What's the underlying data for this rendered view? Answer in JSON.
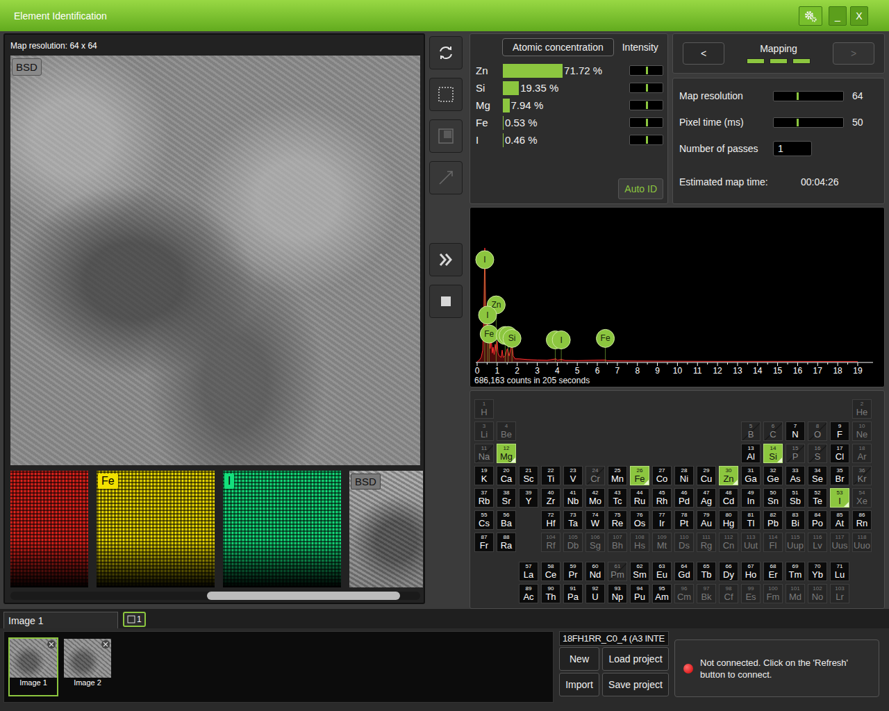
{
  "window": {
    "title": "Element Identification",
    "controls": [
      {
        "kind": "gear",
        "label": ""
      },
      {
        "kind": "minimize",
        "label": "_"
      },
      {
        "kind": "close",
        "label": "X"
      }
    ]
  },
  "image_panel": {
    "header": "Map resolution: 64 x 64",
    "badge": "BSD",
    "maps": [
      {
        "label": "",
        "kind": "color",
        "color": "#e2231c"
      },
      {
        "label": "Fe",
        "kind": "color",
        "color": "#f2e000"
      },
      {
        "label": "I",
        "kind": "color",
        "color": "#14e07c"
      },
      {
        "label": "BSD",
        "kind": "grayscale",
        "color": "#9a9a9a"
      }
    ]
  },
  "toolbar": [
    {
      "kind": "refresh",
      "disabled": false
    },
    {
      "kind": "select-area",
      "disabled": false
    },
    {
      "kind": "crop",
      "disabled": true
    },
    {
      "kind": "line",
      "disabled": true
    },
    {
      "kind": "next",
      "disabled": false
    },
    {
      "kind": "stop",
      "disabled": false
    }
  ],
  "concentration": {
    "tab": "Atomic concentration",
    "intensity_header": "Intensity",
    "auto_id": "Auto ID",
    "rows": [
      {
        "element": "Zn",
        "value": "71.72 %",
        "level": 0.7172,
        "intensity": 0.5
      },
      {
        "element": "Si",
        "value": "19.35 %",
        "level": 0.1935,
        "intensity": 0.5
      },
      {
        "element": "Mg",
        "value": "7.94 %",
        "level": 0.0794,
        "intensity": 0.5
      },
      {
        "element": "Fe",
        "value": "0.53 %",
        "level": 0.0053,
        "intensity": 0.5
      },
      {
        "element": "I",
        "value": "0.46 %",
        "level": 0.0046,
        "intensity": 0.5
      }
    ]
  },
  "mapping": {
    "prev": {
      "label": "<",
      "disabled": false
    },
    "title": "Mapping",
    "next": {
      "label": ">",
      "disabled": true
    },
    "steps": [
      {
        "on": true
      },
      {
        "on": true
      },
      {
        "on": true
      }
    ],
    "settings": [
      {
        "kind": "slider",
        "label": "Map resolution",
        "level": 0.33,
        "value": "64"
      },
      {
        "kind": "slider",
        "label": "Pixel time (ms)",
        "level": 0.33,
        "value": "50"
      },
      {
        "kind": "input",
        "label": "Number of passes",
        "value": "1"
      },
      {
        "kind": "readout",
        "label": "Estimated map time:",
        "value": "00:04:26"
      }
    ]
  },
  "spectrum": {
    "x_ticks": [
      "0",
      "1",
      "2",
      "3",
      "4",
      "5",
      "6",
      "7",
      "8",
      "9",
      "10",
      "11",
      "12",
      "13",
      "14",
      "15",
      "16",
      "17",
      "18",
      "19"
    ],
    "energies_keV": [
      0,
      0.1,
      0.2,
      0.28,
      0.33,
      0.38,
      0.42,
      0.47,
      0.52,
      0.56,
      0.6,
      0.65,
      0.7,
      0.76,
      0.8,
      0.85,
      0.9,
      0.95,
      1.0,
      1.04,
      1.1,
      1.2,
      1.25,
      1.3,
      1.4,
      1.5,
      1.6,
      1.74,
      1.8,
      1.9,
      2.1,
      2.5,
      3.0,
      3.5,
      3.94,
      4.0,
      4.2,
      4.4,
      5,
      6.4,
      6.5,
      7,
      8,
      10,
      12,
      15,
      19
    ],
    "counts": [
      0,
      1,
      3,
      8,
      30,
      78,
      40,
      18,
      32,
      14,
      22,
      9,
      16,
      6,
      10,
      5,
      12,
      7,
      14,
      6,
      4,
      3,
      8,
      3,
      4,
      9,
      4,
      13,
      4,
      2,
      2,
      1.5,
      1.2,
      1,
      2,
      1,
      1.6,
      0.9,
      0.8,
      1.2,
      0.7,
      0.6,
      0.5,
      0.4,
      0.3,
      0.3,
      0.2
    ],
    "markers": [
      {
        "label": "I",
        "energy": 0.38,
        "counts": 70
      },
      {
        "label": "Zn",
        "energy": 0.95,
        "counts": 39
      },
      {
        "label": "I",
        "energy": 0.52,
        "counts": 32
      },
      {
        "label": "Fe",
        "energy": 0.6,
        "counts": 19
      },
      {
        "label": "",
        "energy": 1.4,
        "counts": 18
      },
      {
        "label": "",
        "energy": 1.55,
        "counts": 18
      },
      {
        "label": "Si",
        "energy": 1.74,
        "counts": 16
      },
      {
        "label": "",
        "energy": 3.9,
        "counts": 15
      },
      {
        "label": "I",
        "energy": 4.2,
        "counts": 15
      },
      {
        "label": "Fe",
        "energy": 6.4,
        "counts": 16
      }
    ],
    "summary": "686,163 counts in 205 seconds"
  },
  "periodic_table": {
    "elements": [
      {
        "z": "1",
        "symbol": "H",
        "state": "disabled"
      },
      {
        "z": "2",
        "symbol": "He",
        "state": "disabled"
      },
      {
        "z": "3",
        "symbol": "Li",
        "state": "disabled"
      },
      {
        "z": "4",
        "symbol": "Be",
        "state": "disabled"
      },
      {
        "z": "5",
        "symbol": "B",
        "state": "excluded"
      },
      {
        "z": "6",
        "symbol": "C",
        "state": "excluded"
      },
      {
        "z": "7",
        "symbol": "N",
        "state": "normal"
      },
      {
        "z": "8",
        "symbol": "O",
        "state": "excluded"
      },
      {
        "z": "9",
        "symbol": "F",
        "state": "normal"
      },
      {
        "z": "10",
        "symbol": "Ne",
        "state": "disabled"
      },
      {
        "z": "11",
        "symbol": "Na",
        "state": "excluded"
      },
      {
        "z": "12",
        "symbol": "Mg",
        "state": "selected"
      },
      {
        "z": "13",
        "symbol": "Al",
        "state": "normal"
      },
      {
        "z": "14",
        "symbol": "Si",
        "state": "selected"
      },
      {
        "z": "15",
        "symbol": "P",
        "state": "excluded"
      },
      {
        "z": "16",
        "symbol": "S",
        "state": "excluded"
      },
      {
        "z": "17",
        "symbol": "Cl",
        "state": "normal"
      },
      {
        "z": "18",
        "symbol": "Ar",
        "state": "disabled"
      },
      {
        "z": "19",
        "symbol": "K",
        "state": "normal"
      },
      {
        "z": "20",
        "symbol": "Ca",
        "state": "normal"
      },
      {
        "z": "21",
        "symbol": "Sc",
        "state": "normal"
      },
      {
        "z": "22",
        "symbol": "Ti",
        "state": "normal"
      },
      {
        "z": "23",
        "symbol": "V",
        "state": "normal"
      },
      {
        "z": "24",
        "symbol": "Cr",
        "state": "excluded"
      },
      {
        "z": "25",
        "symbol": "Mn",
        "state": "normal"
      },
      {
        "z": "26",
        "symbol": "Fe",
        "state": "selected"
      },
      {
        "z": "27",
        "symbol": "Co",
        "state": "normal"
      },
      {
        "z": "28",
        "symbol": "Ni",
        "state": "normal"
      },
      {
        "z": "29",
        "symbol": "Cu",
        "state": "normal"
      },
      {
        "z": "30",
        "symbol": "Zn",
        "state": "selected"
      },
      {
        "z": "31",
        "symbol": "Ga",
        "state": "normal"
      },
      {
        "z": "32",
        "symbol": "Ge",
        "state": "normal"
      },
      {
        "z": "33",
        "symbol": "As",
        "state": "normal"
      },
      {
        "z": "34",
        "symbol": "Se",
        "state": "normal"
      },
      {
        "z": "35",
        "symbol": "Br",
        "state": "normal"
      },
      {
        "z": "36",
        "symbol": "Kr",
        "state": "excluded"
      },
      {
        "z": "37",
        "symbol": "Rb",
        "state": "normal"
      },
      {
        "z": "38",
        "symbol": "Sr",
        "state": "normal"
      },
      {
        "z": "39",
        "symbol": "Y",
        "state": "normal"
      },
      {
        "z": "40",
        "symbol": "Zr",
        "state": "normal"
      },
      {
        "z": "41",
        "symbol": "Nb",
        "state": "normal"
      },
      {
        "z": "42",
        "symbol": "Mo",
        "state": "normal"
      },
      {
        "z": "43",
        "symbol": "Tc",
        "state": "normal"
      },
      {
        "z": "44",
        "symbol": "Ru",
        "state": "normal"
      },
      {
        "z": "45",
        "symbol": "Rh",
        "state": "normal"
      },
      {
        "z": "46",
        "symbol": "Pd",
        "state": "normal"
      },
      {
        "z": "47",
        "symbol": "Ag",
        "state": "normal"
      },
      {
        "z": "48",
        "symbol": "Cd",
        "state": "normal"
      },
      {
        "z": "49",
        "symbol": "In",
        "state": "normal"
      },
      {
        "z": "50",
        "symbol": "Sn",
        "state": "normal"
      },
      {
        "z": "51",
        "symbol": "Sb",
        "state": "normal"
      },
      {
        "z": "52",
        "symbol": "Te",
        "state": "normal"
      },
      {
        "z": "53",
        "symbol": "I",
        "state": "selected"
      },
      {
        "z": "54",
        "symbol": "Xe",
        "state": "disabled"
      },
      {
        "z": "55",
        "symbol": "Cs",
        "state": "normal"
      },
      {
        "z": "56",
        "symbol": "Ba",
        "state": "normal"
      },
      {
        "z": "57",
        "symbol": "La",
        "state": "normal"
      },
      {
        "z": "58",
        "symbol": "Ce",
        "state": "normal"
      },
      {
        "z": "59",
        "symbol": "Pr",
        "state": "normal"
      },
      {
        "z": "60",
        "symbol": "Nd",
        "state": "normal"
      },
      {
        "z": "61",
        "symbol": "Pm",
        "state": "excluded"
      },
      {
        "z": "62",
        "symbol": "Sm",
        "state": "normal"
      },
      {
        "z": "63",
        "symbol": "Eu",
        "state": "normal"
      },
      {
        "z": "64",
        "symbol": "Gd",
        "state": "normal"
      },
      {
        "z": "65",
        "symbol": "Tb",
        "state": "normal"
      },
      {
        "z": "66",
        "symbol": "Dy",
        "state": "normal"
      },
      {
        "z": "67",
        "symbol": "Ho",
        "state": "normal"
      },
      {
        "z": "68",
        "symbol": "Er",
        "state": "normal"
      },
      {
        "z": "69",
        "symbol": "Tm",
        "state": "normal"
      },
      {
        "z": "70",
        "symbol": "Yb",
        "state": "normal"
      },
      {
        "z": "71",
        "symbol": "Lu",
        "state": "normal"
      },
      {
        "z": "72",
        "symbol": "Hf",
        "state": "normal"
      },
      {
        "z": "73",
        "symbol": "Ta",
        "state": "normal"
      },
      {
        "z": "74",
        "symbol": "W",
        "state": "normal"
      },
      {
        "z": "75",
        "symbol": "Re",
        "state": "normal"
      },
      {
        "z": "76",
        "symbol": "Os",
        "state": "normal"
      },
      {
        "z": "77",
        "symbol": "Ir",
        "state": "normal"
      },
      {
        "z": "78",
        "symbol": "Pt",
        "state": "normal"
      },
      {
        "z": "79",
        "symbol": "Au",
        "state": "normal"
      },
      {
        "z": "80",
        "symbol": "Hg",
        "state": "normal"
      },
      {
        "z": "81",
        "symbol": "Tl",
        "state": "normal"
      },
      {
        "z": "82",
        "symbol": "Pb",
        "state": "normal"
      },
      {
        "z": "83",
        "symbol": "Bi",
        "state": "normal"
      },
      {
        "z": "84",
        "symbol": "Po",
        "state": "normal"
      },
      {
        "z": "85",
        "symbol": "At",
        "state": "normal"
      },
      {
        "z": "86",
        "symbol": "Rn",
        "state": "normal"
      },
      {
        "z": "87",
        "symbol": "Fr",
        "state": "normal"
      },
      {
        "z": "88",
        "symbol": "Ra",
        "state": "normal"
      },
      {
        "z": "89",
        "symbol": "Ac",
        "state": "normal"
      },
      {
        "z": "90",
        "symbol": "Th",
        "state": "normal"
      },
      {
        "z": "91",
        "symbol": "Pa",
        "state": "normal"
      },
      {
        "z": "92",
        "symbol": "U",
        "state": "normal"
      },
      {
        "z": "93",
        "symbol": "Np",
        "state": "normal"
      },
      {
        "z": "94",
        "symbol": "Pu",
        "state": "normal"
      },
      {
        "z": "95",
        "symbol": "Am",
        "state": "normal"
      },
      {
        "z": "96",
        "symbol": "Cm",
        "state": "disabled"
      },
      {
        "z": "97",
        "symbol": "Bk",
        "state": "disabled"
      },
      {
        "z": "98",
        "symbol": "Cf",
        "state": "disabled"
      },
      {
        "z": "99",
        "symbol": "Es",
        "state": "disabled"
      },
      {
        "z": "100",
        "symbol": "Fm",
        "state": "disabled"
      },
      {
        "z": "101",
        "symbol": "Md",
        "state": "disabled"
      },
      {
        "z": "102",
        "symbol": "No",
        "state": "disabled"
      },
      {
        "z": "103",
        "symbol": "Lr",
        "state": "disabled"
      },
      {
        "z": "104",
        "symbol": "Rf",
        "state": "disabled"
      },
      {
        "z": "105",
        "symbol": "Db",
        "state": "disabled"
      },
      {
        "z": "106",
        "symbol": "Sg",
        "state": "disabled"
      },
      {
        "z": "107",
        "symbol": "Bh",
        "state": "disabled"
      },
      {
        "z": "108",
        "symbol": "Hs",
        "state": "disabled"
      },
      {
        "z": "109",
        "symbol": "Mt",
        "state": "disabled"
      },
      {
        "z": "110",
        "symbol": "Ds",
        "state": "disabled"
      },
      {
        "z": "111",
        "symbol": "Rg",
        "state": "disabled"
      },
      {
        "z": "112",
        "symbol": "Cn",
        "state": "disabled"
      },
      {
        "z": "113",
        "symbol": "Uut",
        "state": "disabled"
      },
      {
        "z": "114",
        "symbol": "Fl",
        "state": "disabled"
      },
      {
        "z": "115",
        "symbol": "Uup",
        "state": "disabled"
      },
      {
        "z": "116",
        "symbol": "Lv",
        "state": "disabled"
      },
      {
        "z": "117",
        "symbol": "Uus",
        "state": "disabled"
      },
      {
        "z": "118",
        "symbol": "Uuo",
        "state": "disabled"
      }
    ]
  },
  "image_tabs": [
    {
      "label": "Image 1",
      "kind": "text",
      "selected": false
    },
    {
      "label": "1",
      "kind": "icon",
      "selected": true
    }
  ],
  "thumbnails": [
    {
      "label": "Image 1",
      "selected": true
    },
    {
      "label": "Image 2",
      "selected": false
    }
  ],
  "project": {
    "name": "18FH1RR_C0_4 (A3 INTE",
    "buttons": [
      "New",
      "Load project",
      "Import",
      "Save project"
    ]
  },
  "status": {
    "connected": false,
    "message": "Not connected. Click on the 'Refresh' button to connect."
  }
}
